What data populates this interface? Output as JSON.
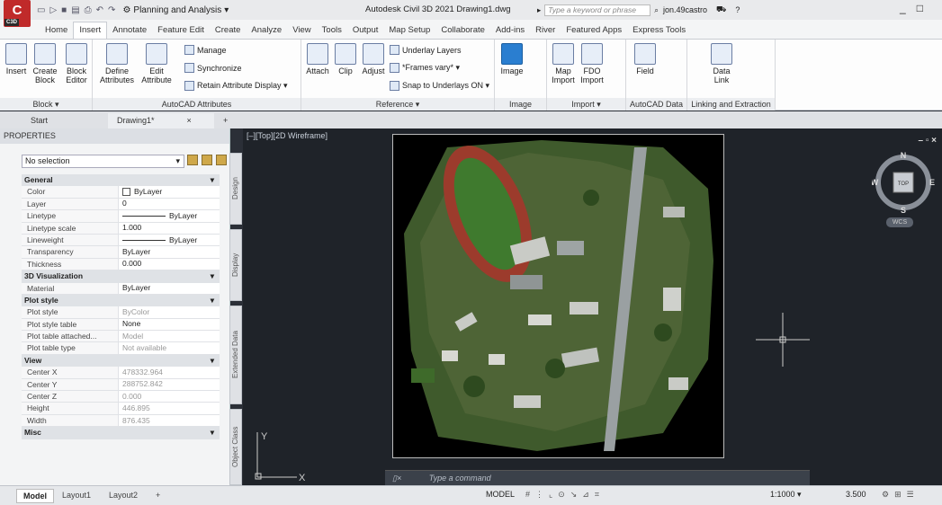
{
  "app": {
    "logo": "C",
    "logo_sub": "C3D",
    "workspace": "Planning and Analysis",
    "title": "Autodesk Civil 3D 2021  Drawing1.dwg",
    "search_placeholder": "Type a keyword or phrase",
    "user": "jon.49castro"
  },
  "ribbon_tabs": [
    "Home",
    "Insert",
    "Annotate",
    "Feature Edit",
    "Create",
    "Analyze",
    "View",
    "Tools",
    "Output",
    "Map Setup",
    "Collaborate",
    "Add-ins",
    "River",
    "Featured Apps",
    "Express Tools"
  ],
  "active_tab": "Insert",
  "ribbon": {
    "block": {
      "label": "Block ▾",
      "insert": "Insert",
      "create_block": "Create Block",
      "block_editor": "Block Editor"
    },
    "attributes": {
      "label": "AutoCAD Attributes",
      "define": "Define Attributes",
      "edit": "Edit Attribute",
      "manage": "Manage",
      "synchronize": "Synchronize",
      "retain": "Retain Attribute Display ▾"
    },
    "reference": {
      "label": "Reference ▾",
      "attach": "Attach",
      "clip": "Clip",
      "adjust": "Adjust",
      "underlay": "Underlay Layers",
      "frames": "*Frames vary* ▾",
      "snap": "Snap to Underlays ON ▾"
    },
    "image": {
      "label": "Image",
      "image": "Image"
    },
    "import": {
      "label": "Import ▾",
      "map": "Map Import",
      "fdo": "FDO Import"
    },
    "autocad_data": {
      "label": "AutoCAD Data",
      "field": "Field"
    },
    "linking": {
      "label": "Linking and Extraction",
      "data_link": "Data Link"
    }
  },
  "doc_tabs": [
    "Start",
    "Drawing1*"
  ],
  "properties": {
    "header": "PROPERTIES",
    "selection": "No selection",
    "sections": [
      {
        "name": "General",
        "rows": [
          [
            "Color",
            "ByLayer"
          ],
          [
            "Layer",
            "0"
          ],
          [
            "Linetype",
            "ByLayer"
          ],
          [
            "Linetype scale",
            "1.000"
          ],
          [
            "Lineweight",
            "ByLayer"
          ],
          [
            "Transparency",
            "ByLayer"
          ],
          [
            "Thickness",
            "0.000"
          ]
        ]
      },
      {
        "name": "3D Visualization",
        "rows": [
          [
            "Material",
            "ByLayer"
          ]
        ]
      },
      {
        "name": "Plot style",
        "rows": [
          [
            "Plot style",
            "ByColor"
          ],
          [
            "Plot style table",
            "None"
          ],
          [
            "Plot table attached...",
            "Model"
          ],
          [
            "Plot table type",
            "Not available"
          ]
        ]
      },
      {
        "name": "View",
        "rows": [
          [
            "Center X",
            "478332.964"
          ],
          [
            "Center Y",
            "288752.842"
          ],
          [
            "Center Z",
            "0.000"
          ],
          [
            "Height",
            "446.895"
          ],
          [
            "Width",
            "876.435"
          ]
        ]
      },
      {
        "name": "Misc",
        "rows": []
      }
    ],
    "side_tabs": [
      "Design",
      "Display",
      "Extended Data",
      "Object Class"
    ]
  },
  "viewport": {
    "label": "[–][Top][2D Wireframe]",
    "controls": "– ▫ ×",
    "cube": {
      "n": "N",
      "s": "S",
      "e": "E",
      "w": "W",
      "top": "TOP",
      "wcs": "WCS"
    }
  },
  "command": {
    "placeholder": "Type a command"
  },
  "layout_tabs": [
    "Model",
    "Layout1",
    "Layout2"
  ],
  "status": {
    "model": "MODEL",
    "scale": "1:1000 ▾",
    "value": "3.500"
  }
}
